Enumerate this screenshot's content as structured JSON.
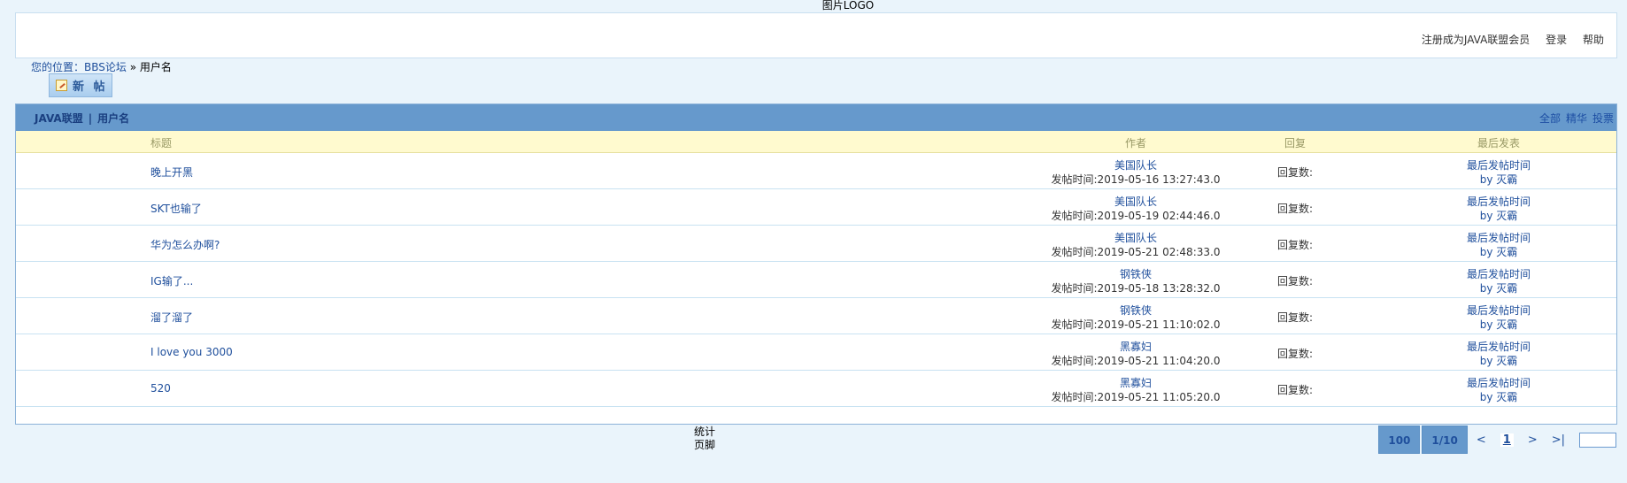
{
  "header": {
    "logo_text": "图片LOGO",
    "links": [
      "注册成为JAVA联盟会员",
      "登录",
      "帮助"
    ]
  },
  "breadcrumb": {
    "prefix": "您的位置：",
    "forum": "BBS论坛",
    "separator": "»",
    "current": "用户名"
  },
  "new_post_button": {
    "label": "新 帖",
    "icon": "edit-icon"
  },
  "board": {
    "name": "JAVA联盟",
    "separator": "|",
    "user": "用户名",
    "filters": [
      "全部",
      "精华",
      "投票"
    ],
    "columns": [
      "标题",
      "作者",
      "回复",
      "最后发表"
    ],
    "posts": [
      {
        "title": "晚上开黑",
        "author": "美国队长",
        "post_time": "发帖时间:2019-05-16 13:27:43.0",
        "reply": "回复数:",
        "last_label": "最后发帖时间",
        "last_by": "by 灭霸"
      },
      {
        "title": "SKT也输了",
        "author": "美国队长",
        "post_time": "发帖时间:2019-05-19 02:44:46.0",
        "reply": "回复数:",
        "last_label": "最后发帖时间",
        "last_by": "by 灭霸"
      },
      {
        "title": "华为怎么办啊?",
        "author": "美国队长",
        "post_time": "发帖时间:2019-05-21 02:48:33.0",
        "reply": "回复数:",
        "last_label": "最后发帖时间",
        "last_by": "by 灭霸"
      },
      {
        "title": "IG输了...",
        "author": "钢铁侠",
        "post_time": "发帖时间:2019-05-18 13:28:32.0",
        "reply": "回复数:",
        "last_label": "最后发帖时间",
        "last_by": "by 灭霸"
      },
      {
        "title": "溜了溜了",
        "author": "钢铁侠",
        "post_time": "发帖时间:2019-05-21 11:10:02.0",
        "reply": "回复数:",
        "last_label": "最后发帖时间",
        "last_by": "by 灭霸"
      },
      {
        "title": "I love you 3000",
        "author": "黑寡妇",
        "post_time": "发帖时间:2019-05-21 11:04:20.0",
        "reply": "回复数:",
        "last_label": "最后发帖时间",
        "last_by": "by 灭霸"
      },
      {
        "title": "520",
        "author": "黑寡妇",
        "post_time": "发帖时间:2019-05-21 11:05:20.0",
        "reply": "回复数:",
        "last_label": "最后发帖时间",
        "last_by": "by 灭霸"
      }
    ]
  },
  "footer": {
    "stats": "统计",
    "foot": "页脚"
  },
  "pager": {
    "total": "100",
    "pages": "1/10",
    "prev": "<",
    "current": "1",
    "next": ">",
    "last": ">|",
    "goto_value": ""
  },
  "colors": {
    "accent": "#6699cc",
    "link": "#1f4f9c",
    "header_row": "#fffacf"
  }
}
